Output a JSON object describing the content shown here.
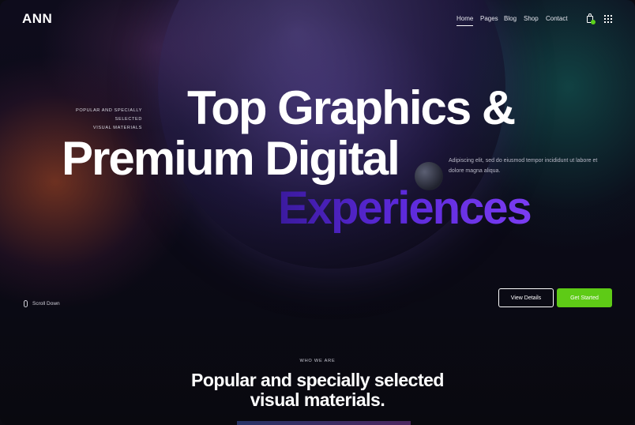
{
  "header": {
    "logo": "ANN",
    "nav": [
      {
        "label": "Home",
        "active": true
      },
      {
        "label": "Pages",
        "active": false
      },
      {
        "label": "Blog",
        "active": false
      },
      {
        "label": "Shop",
        "active": false
      },
      {
        "label": "Contact",
        "active": false
      }
    ],
    "icons": {
      "cart": "shopping-bag-icon",
      "menu": "grid-menu-icon"
    }
  },
  "hero": {
    "eyebrow_line1": "POPULAR AND SPECIALLY SELECTED",
    "eyebrow_line2": "VISUAL MATERIALS",
    "headline_line1": "Top Graphics &",
    "headline_line2": "Premium Digital",
    "headline_line3": "Experiences",
    "description": "Adipiscing elit, sed do eiusmod tempor incididunt ut labore et dolore magna aliqua.",
    "scroll_label": "Scroll Down",
    "buttons": {
      "secondary": "View Details",
      "primary": "Get Started"
    }
  },
  "about": {
    "eyebrow": "WHO WE ARE",
    "title_line1": "Popular and specially selected",
    "title_line2": "visual materials."
  },
  "colors": {
    "accent_green": "#5ecb16",
    "headline_purple": "#5a28d8",
    "background": "#0b0a16"
  }
}
